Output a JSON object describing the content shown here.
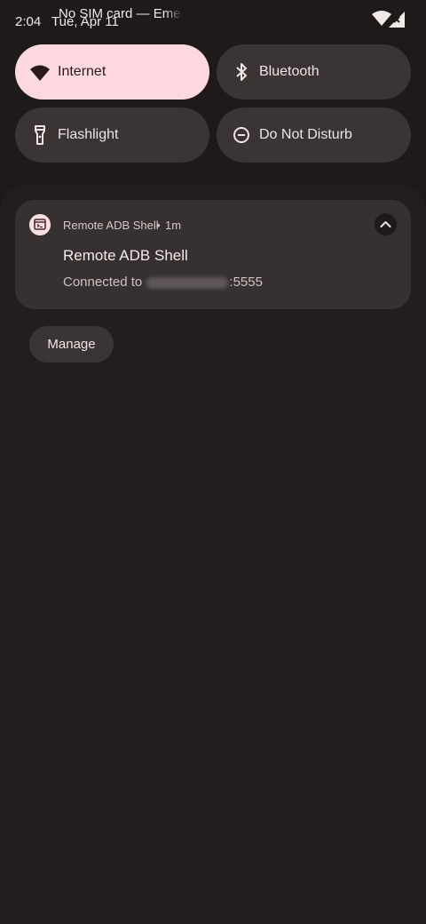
{
  "status_bar": {
    "time": "2:04",
    "date": "Tue, Apr 11",
    "carrier": "No SIM card — Emergency calls only",
    "icons": [
      "wifi-icon",
      "no-sim-signal-icon"
    ]
  },
  "quick_settings": {
    "tiles": [
      {
        "label": "Internet",
        "icon": "wifi-icon",
        "active": true
      },
      {
        "label": "Bluetooth",
        "icon": "bluetooth-icon",
        "active": false
      },
      {
        "label": "Flashlight",
        "icon": "flashlight-icon",
        "active": false
      },
      {
        "label": "Do Not Disturb",
        "icon": "do-not-disturb-icon",
        "active": false
      }
    ]
  },
  "notification": {
    "app_name": "Remote ADB Shell",
    "separator": "•",
    "time": "1m",
    "title": "Remote ADB Shell",
    "text_prefix": "Connected to ",
    "text_suffix": ":5555",
    "icons": [
      "app-terminal-icon",
      "chevron-up-icon"
    ]
  },
  "actions": {
    "manage_label": "Manage"
  },
  "colors": {
    "background": "#1e1a1a",
    "tile": "#3a3434",
    "tile_active": "#fdd9df",
    "card": "#363030"
  }
}
